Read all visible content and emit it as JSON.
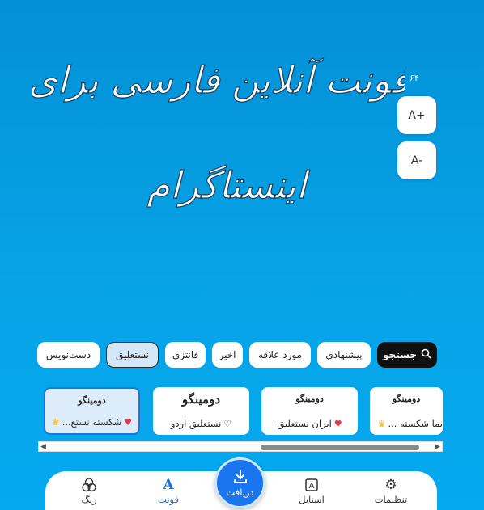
{
  "preview": {
    "text_line1": "فونت آنلاین فارسی برای",
    "text_line2": "اینستاگرام"
  },
  "font_size": {
    "value": "۶۴",
    "increase_label": "A+",
    "decrease_label": "A-"
  },
  "categories": {
    "search_label": "جستجو",
    "items": [
      "پیشنهادی",
      "مورد علاقه",
      "اخیر",
      "فانتزی",
      "نستعلیق",
      "دست‌نویس"
    ],
    "active": "نستعلیق"
  },
  "font_cards": [
    {
      "sample": "دومینگو",
      "name": "یما شکسته ...",
      "badge": "crown"
    },
    {
      "sample": "دومینگو",
      "name": "ایران نستعلیق",
      "badge": "heart-filled"
    },
    {
      "sample": "دومینگو",
      "name": "نستعلیق اردو",
      "badge": "heart-outline"
    },
    {
      "sample": "دومینگو",
      "name": "شکسته نستع...",
      "badge": "crown",
      "badge2": "heart-filled",
      "selected": true
    }
  ],
  "nav": {
    "settings": "تنظیمات",
    "style": "استایل",
    "download": "دریافت",
    "font": "فونت",
    "color": "رنگ"
  },
  "colors": {
    "accent": "#1976f0",
    "background": "#05a3e6",
    "active_nav": "#1b6fd6"
  }
}
